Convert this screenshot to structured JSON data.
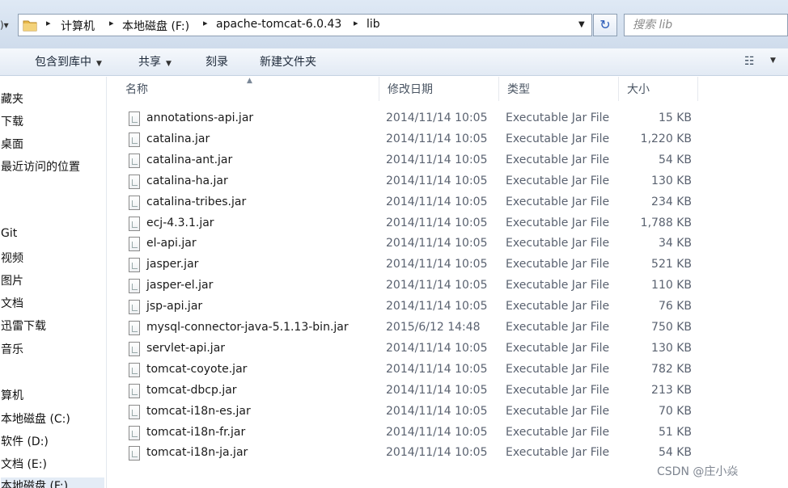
{
  "address": {
    "left_glyph": ")▾",
    "breadcrumbs": [
      "计算机",
      "本地磁盘 (F:)",
      "apache-tomcat-6.0.43",
      "lib"
    ],
    "separator": "▸",
    "dropdown": "▼",
    "refresh": "↻"
  },
  "search": {
    "placeholder": "搜索 lib"
  },
  "toolbar": {
    "buttons": [
      {
        "label": "包含到库中",
        "has_menu": true
      },
      {
        "label": "共享",
        "has_menu": true
      },
      {
        "label": "刻录",
        "has_menu": false
      },
      {
        "label": "新建文件夹",
        "has_menu": false
      }
    ],
    "caret": "▼",
    "view_glyph": "☷",
    "view_caret": "▼"
  },
  "nav": {
    "items": [
      "藏夹",
      "下载",
      "桌面",
      "最近访问的位置",
      "Git",
      "视频",
      "图片",
      "文档",
      "迅雷下载",
      "音乐",
      "算机",
      "本地磁盘 (C:)",
      "软件 (D:)",
      "文档 (E:)",
      "本地磁盘 (F:)"
    ]
  },
  "columns": {
    "name": "名称",
    "date": "修改日期",
    "type": "类型",
    "size": "大小",
    "sort_indicator": "▲"
  },
  "files": [
    {
      "name": "annotations-api.jar",
      "date": "2014/11/14 10:05",
      "type": "Executable Jar File",
      "size": "15 KB"
    },
    {
      "name": "catalina.jar",
      "date": "2014/11/14 10:05",
      "type": "Executable Jar File",
      "size": "1,220 KB"
    },
    {
      "name": "catalina-ant.jar",
      "date": "2014/11/14 10:05",
      "type": "Executable Jar File",
      "size": "54 KB"
    },
    {
      "name": "catalina-ha.jar",
      "date": "2014/11/14 10:05",
      "type": "Executable Jar File",
      "size": "130 KB"
    },
    {
      "name": "catalina-tribes.jar",
      "date": "2014/11/14 10:05",
      "type": "Executable Jar File",
      "size": "234 KB"
    },
    {
      "name": "ecj-4.3.1.jar",
      "date": "2014/11/14 10:05",
      "type": "Executable Jar File",
      "size": "1,788 KB"
    },
    {
      "name": "el-api.jar",
      "date": "2014/11/14 10:05",
      "type": "Executable Jar File",
      "size": "34 KB"
    },
    {
      "name": "jasper.jar",
      "date": "2014/11/14 10:05",
      "type": "Executable Jar File",
      "size": "521 KB"
    },
    {
      "name": "jasper-el.jar",
      "date": "2014/11/14 10:05",
      "type": "Executable Jar File",
      "size": "110 KB"
    },
    {
      "name": "jsp-api.jar",
      "date": "2014/11/14 10:05",
      "type": "Executable Jar File",
      "size": "76 KB"
    },
    {
      "name": "mysql-connector-java-5.1.13-bin.jar",
      "date": "2015/6/12 14:48",
      "type": "Executable Jar File",
      "size": "750 KB"
    },
    {
      "name": "servlet-api.jar",
      "date": "2014/11/14 10:05",
      "type": "Executable Jar File",
      "size": "130 KB"
    },
    {
      "name": "tomcat-coyote.jar",
      "date": "2014/11/14 10:05",
      "type": "Executable Jar File",
      "size": "782 KB"
    },
    {
      "name": "tomcat-dbcp.jar",
      "date": "2014/11/14 10:05",
      "type": "Executable Jar File",
      "size": "213 KB"
    },
    {
      "name": "tomcat-i18n-es.jar",
      "date": "2014/11/14 10:05",
      "type": "Executable Jar File",
      "size": "70 KB"
    },
    {
      "name": "tomcat-i18n-fr.jar",
      "date": "2014/11/14 10:05",
      "type": "Executable Jar File",
      "size": "51 KB"
    },
    {
      "name": "tomcat-i18n-ja.jar",
      "date": "2014/11/14 10:05",
      "type": "Executable Jar File",
      "size": "54 KB"
    }
  ],
  "watermark": "CSDN @庄小焱",
  "colors": {
    "folder": "#e8b84a",
    "header_bg": "#dfe9f5",
    "toolbar_bg": "#e8eef6",
    "accent": "#2a5bb8"
  }
}
